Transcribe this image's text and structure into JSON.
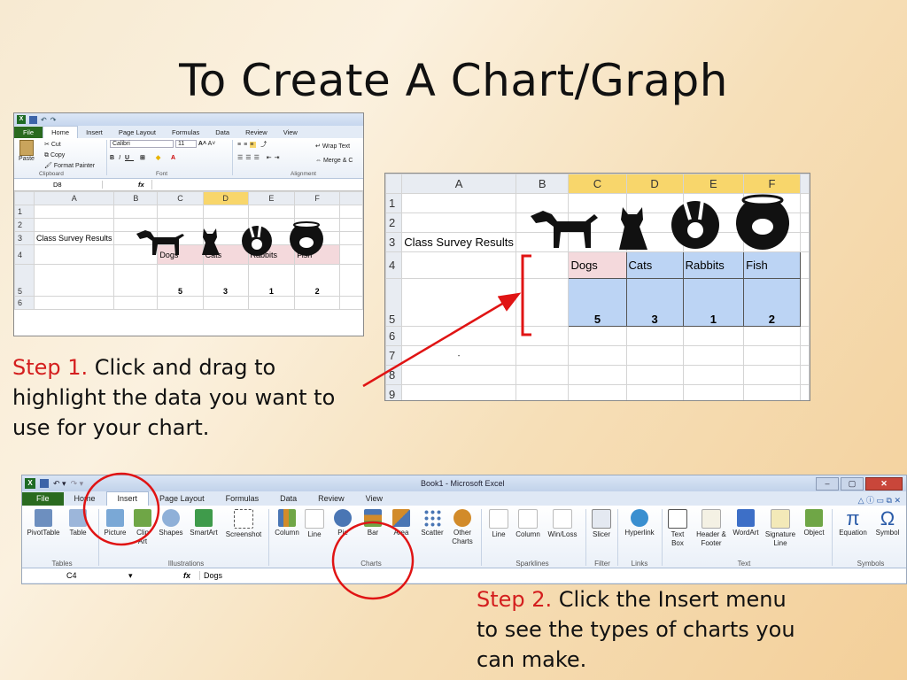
{
  "slide": {
    "title": "To Create A Chart/Graph"
  },
  "steps": [
    {
      "label": "Step 1.",
      "text": " Click and drag to highlight the data you want to use for your chart."
    },
    {
      "label": "Step 2.",
      "text": " Click the Insert menu to see the types of charts you can make."
    }
  ],
  "small_excel": {
    "tabs": [
      "File",
      "Home",
      "Insert",
      "Page Layout",
      "Formulas",
      "Data",
      "Review",
      "View"
    ],
    "active_tab": "Home",
    "clipboard": {
      "paste": "Paste",
      "cut": "Cut",
      "copy": "Copy",
      "format_painter": "Format Painter",
      "group": "Clipboard"
    },
    "font": {
      "name": "Calibri",
      "size": "11",
      "group": "Font"
    },
    "alignment": {
      "wrap": "Wrap Text",
      "merge": "Merge & C",
      "group": "Alignment"
    },
    "name_box": "D8",
    "fx": "fx",
    "columns": [
      "A",
      "B",
      "C",
      "D",
      "E",
      "F"
    ],
    "rows": [
      "1",
      "2",
      "3",
      "4",
      "5",
      "6"
    ],
    "a3": "Class Survey Results",
    "headers": [
      "Dogs",
      "Cats",
      "Rabbits",
      "Fish"
    ],
    "values": [
      "5",
      "3",
      "1",
      "2"
    ]
  },
  "big_grid": {
    "columns": [
      "A",
      "B",
      "C",
      "D",
      "E",
      "F"
    ],
    "rows": [
      "1",
      "2",
      "3",
      "4",
      "5",
      "6",
      "7",
      "8",
      "9"
    ],
    "a3": "Class Survey Results",
    "headers": [
      "Dogs",
      "Cats",
      "Rabbits",
      "Fish"
    ],
    "values": [
      "5",
      "3",
      "1",
      "2"
    ],
    "a7_mark": "-"
  },
  "ribbon": {
    "window_title": "Book1 - Microsoft Excel",
    "tabs": [
      "File",
      "Home",
      "Insert",
      "Page Layout",
      "Formulas",
      "Data",
      "Review",
      "View"
    ],
    "active_tab": "Insert",
    "buttons": {
      "pivottable": "PivotTable",
      "table": "Table",
      "picture": "Picture",
      "clipart": "Clip Art",
      "shapes": "Shapes",
      "smartart": "SmartArt",
      "screenshot": "Screenshot",
      "column": "Column",
      "line": "Line",
      "pie": "Pie",
      "bar": "Bar",
      "area": "Area",
      "scatter": "Scatter",
      "other": "Other Charts",
      "sp_line": "Line",
      "sp_column": "Column",
      "sp_winloss": "Win/Loss",
      "slicer": "Slicer",
      "hyperlink": "Hyperlink",
      "textbox": "Text Box",
      "headerfooter": "Header & Footer",
      "wordart": "WordArt",
      "signature": "Signature Line",
      "object": "Object",
      "equation": "Equation",
      "symbol": "Symbol"
    },
    "groups": {
      "tables": "Tables",
      "illustrations": "Illustrations",
      "charts": "Charts",
      "sparklines": "Sparklines",
      "filter": "Filter",
      "links": "Links",
      "text": "Text",
      "symbols": "Symbols"
    },
    "name_box": "C4",
    "fx": "fx",
    "formula": "Dogs"
  },
  "colors": {
    "step_label": "#d41e1e",
    "selection": "#bcd4f4",
    "active_col": "#f8d66b",
    "annotation": "#e01414"
  }
}
